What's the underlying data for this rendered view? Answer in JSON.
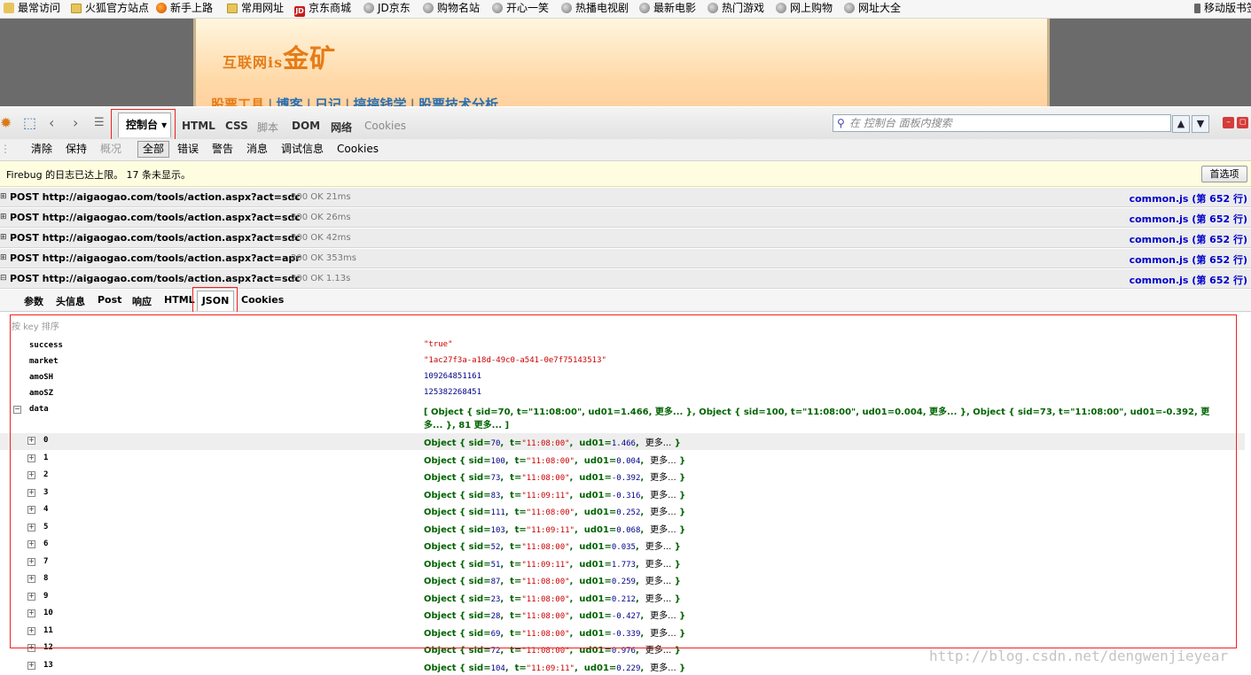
{
  "bookmarks": [
    {
      "label": "最常访问",
      "icon": "bookmark-star-icon"
    },
    {
      "label": "火狐官方站点",
      "icon": "folder-icon"
    },
    {
      "label": "新手上路",
      "icon": "firefox-icon"
    },
    {
      "label": "常用网址",
      "icon": "folder-icon"
    },
    {
      "label": "京东商城",
      "icon": "jd-icon",
      "badge": "JD"
    },
    {
      "label": "JD京东",
      "icon": "globe-icon"
    },
    {
      "label": "购物名站",
      "icon": "globe-icon"
    },
    {
      "label": "开心一笑",
      "icon": "globe-icon"
    },
    {
      "label": "热播电视剧",
      "icon": "globe-icon"
    },
    {
      "label": "最新电影",
      "icon": "globe-icon"
    },
    {
      "label": "热门游戏",
      "icon": "globe-icon"
    },
    {
      "label": "网上购物",
      "icon": "globe-icon"
    },
    {
      "label": "网址大全",
      "icon": "globe-icon"
    },
    {
      "label": "移动版书签",
      "icon": "phone-icon"
    }
  ],
  "site": {
    "logo_main": "互联网",
    "logo_small": "is",
    "logo_tail": "金矿",
    "nav": [
      "股票工具",
      "博客",
      "日记",
      "搞搞钱学",
      "股票技术分析"
    ]
  },
  "firebug": {
    "panels": {
      "console": "控制台 ▾",
      "html": "HTML",
      "css": "CSS",
      "script": "脚本",
      "dom": "DOM",
      "net": "网络",
      "cookies": "Cookies"
    },
    "search_placeholder": "在 控制台 面板内搜索",
    "console_toolbar": {
      "clear": "清除",
      "persist": "保持",
      "profile": "概况",
      "all": "全部",
      "errors": "错误",
      "warnings": "警告",
      "info": "消息",
      "debug": "调试信息",
      "cookies": "Cookies"
    },
    "notice": "Firebug 的日志已达上限。 17 条未显示。",
    "prefs_button": "首选项"
  },
  "requests": [
    {
      "text": "POST http://aigaogao.com/tools/action.aspx?act=sdc",
      "status": "200 OK 21ms",
      "source": "common.js (第 652 行)"
    },
    {
      "text": "POST http://aigaogao.com/tools/action.aspx?act=sdc",
      "status": "200 OK 26ms",
      "source": "common.js (第 652 行)"
    },
    {
      "text": "POST http://aigaogao.com/tools/action.aspx?act=sdc",
      "status": "200 OK 42ms",
      "source": "common.js (第 652 行)"
    },
    {
      "text": "POST http://aigaogao.com/tools/action.aspx?act=apr",
      "status": "200 OK 353ms",
      "source": "common.js (第 652 行)"
    },
    {
      "text": "POST http://aigaogao.com/tools/action.aspx?act=sdc",
      "status": "200 OK 1.13s",
      "source": "common.js (第 652 行)"
    }
  ],
  "response_tabs": [
    "参数",
    "头信息",
    "Post",
    "响应",
    "HTML",
    "JSON",
    "Cookies"
  ],
  "json_view": {
    "sort_label": "按 key 排序",
    "fields": [
      {
        "key": "success",
        "value": "\"true\"",
        "kind": "str"
      },
      {
        "key": "market",
        "value": "\"1ac27f3a-a18d-49c0-a541-0e7f75143513\"",
        "kind": "str"
      },
      {
        "key": "amoSH",
        "value": "109264851161",
        "kind": "num"
      },
      {
        "key": "amoSZ",
        "value": "125382268451",
        "kind": "num"
      }
    ],
    "data_key": "data",
    "data_summary_line1": "[ Object { sid=70, t=\"11:08:00\", ud01=1.466, 更多... }, Object { sid=100, t=\"11:08:00\", ud01=0.004, 更多... }, Object { sid=73, t=\"11:08:00\", ud01=-0.392, 更",
    "data_summary_line2": "多... }, 81 更多... ]",
    "items": [
      {
        "index": "0",
        "sid": "70",
        "t": "\"11:08:00\"",
        "ud01": "1.466"
      },
      {
        "index": "1",
        "sid": "100",
        "t": "\"11:08:00\"",
        "ud01": "0.004"
      },
      {
        "index": "2",
        "sid": "73",
        "t": "\"11:08:00\"",
        "ud01": "-0.392"
      },
      {
        "index": "3",
        "sid": "83",
        "t": "\"11:09:11\"",
        "ud01": "-0.316"
      },
      {
        "index": "4",
        "sid": "111",
        "t": "\"11:08:00\"",
        "ud01": "0.252"
      },
      {
        "index": "5",
        "sid": "103",
        "t": "\"11:09:11\"",
        "ud01": "0.068"
      },
      {
        "index": "6",
        "sid": "52",
        "t": "\"11:08:00\"",
        "ud01": "0.035"
      },
      {
        "index": "7",
        "sid": "51",
        "t": "\"11:09:11\"",
        "ud01": "1.773"
      },
      {
        "index": "8",
        "sid": "87",
        "t": "\"11:08:00\"",
        "ud01": "0.259"
      },
      {
        "index": "9",
        "sid": "23",
        "t": "\"11:08:00\"",
        "ud01": "0.212"
      },
      {
        "index": "10",
        "sid": "28",
        "t": "\"11:08:00\"",
        "ud01": "-0.427"
      },
      {
        "index": "11",
        "sid": "69",
        "t": "\"11:08:00\"",
        "ud01": "-0.339"
      },
      {
        "index": "12",
        "sid": "72",
        "t": "\"11:08:00\"",
        "ud01": "0.976"
      },
      {
        "index": "13",
        "sid": "104",
        "t": "\"11:09:11\"",
        "ud01": "0.229"
      }
    ],
    "more_label": "更多..."
  },
  "watermark": "http://blog.csdn.net/dengwenjieyear"
}
